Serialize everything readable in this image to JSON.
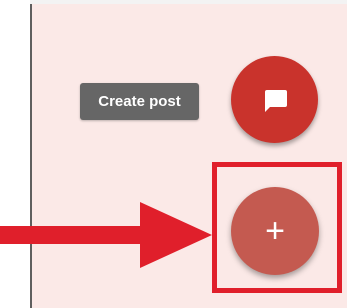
{
  "tooltip": {
    "label": "Create post"
  },
  "fab_chat": {
    "icon": "chat-bubble-icon",
    "color": "#c9332c"
  },
  "fab_add": {
    "label": "+",
    "icon": "plus-icon",
    "color": "#c45a50"
  },
  "annotation": {
    "highlight_color": "#e01f2b",
    "arrow_color": "#e01f2b"
  },
  "colors": {
    "panel_background": "#fbe9e7",
    "tooltip_background": "#666666"
  }
}
